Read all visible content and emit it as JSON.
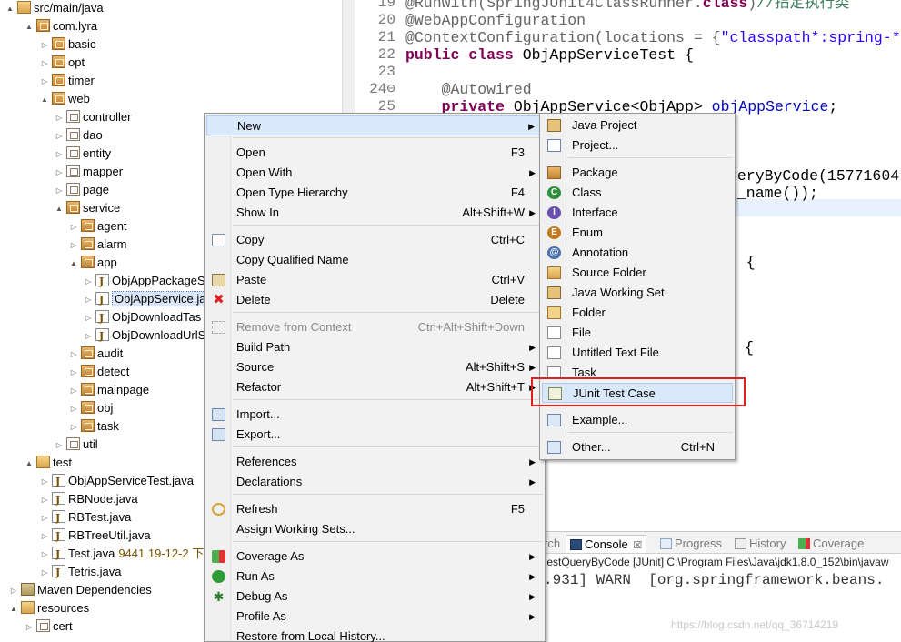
{
  "tree": {
    "rows": [
      {
        "label": "src/main/java"
      },
      {
        "label": "com.lyra"
      },
      {
        "label": "basic"
      },
      {
        "label": "opt"
      },
      {
        "label": "timer"
      },
      {
        "label": "web"
      },
      {
        "label": "controller"
      },
      {
        "label": "dao"
      },
      {
        "label": "entity"
      },
      {
        "label": "mapper"
      },
      {
        "label": "page"
      },
      {
        "label": "service"
      },
      {
        "label": "agent"
      },
      {
        "label": "alarm"
      },
      {
        "label": "app"
      },
      {
        "label": "ObjAppPackageS"
      },
      {
        "label": "ObjAppService.jav"
      },
      {
        "label": "ObjDownloadTas"
      },
      {
        "label": "ObjDownloadUrlS"
      },
      {
        "label": "audit"
      },
      {
        "label": "detect"
      },
      {
        "label": "mainpage"
      },
      {
        "label": "obj"
      },
      {
        "label": "task"
      },
      {
        "label": "util"
      },
      {
        "label": "test"
      },
      {
        "label": "ObjAppServiceTest.java"
      },
      {
        "label": "RBNode.java"
      },
      {
        "label": "RBTest.java"
      },
      {
        "label": "RBTreeUtil.java"
      },
      {
        "label": "Test.java",
        "extra": "9441  19-12-2 下"
      },
      {
        "label": "Tetris.java"
      },
      {
        "label": "Maven Dependencies"
      },
      {
        "label": "resources"
      },
      {
        "label": "cert"
      }
    ]
  },
  "editor": {
    "lines": [
      {
        "n": "19",
        "text": "@RunWith(SpringJUnit4ClassRunner.class)//指定执行类"
      },
      {
        "n": "20",
        "text": "@WebAppConfiguration"
      },
      {
        "n": "21",
        "text": "@ContextConfiguration(locations = {\"classpath*:spring-*"
      },
      {
        "n": "22",
        "text": "public class ObjAppServiceTest {"
      },
      {
        "n": "23",
        "text": ""
      },
      {
        "n": "24⊖",
        "text": "    @Autowired"
      },
      {
        "n": "25",
        "text": "    private ObjAppService<ObjApp> objAppService;"
      }
    ],
    "fragments": [
      "ueryByCode(15771604",
      "p_name());",
      ") {",
      "{"
    ]
  },
  "context_menu": {
    "items": [
      {
        "label": "New",
        "accel": "",
        "arrow": "▶"
      },
      {
        "label": "Open",
        "accel": "F3"
      },
      {
        "label": "Open With",
        "arrow": "▶"
      },
      {
        "label": "Open Type Hierarchy",
        "accel": "F4"
      },
      {
        "label": "Show In",
        "accel": "Alt+Shift+W",
        "arrow": "▶"
      },
      {
        "label": "Copy",
        "accel": "Ctrl+C"
      },
      {
        "label": "Copy Qualified Name"
      },
      {
        "label": "Paste",
        "accel": "Ctrl+V"
      },
      {
        "label": "Delete",
        "accel": "Delete"
      },
      {
        "label": "Remove from Context",
        "accel": "Ctrl+Alt+Shift+Down"
      },
      {
        "label": "Build Path",
        "arrow": "▶"
      },
      {
        "label": "Source",
        "accel": "Alt+Shift+S",
        "arrow": "▶"
      },
      {
        "label": "Refactor",
        "accel": "Alt+Shift+T",
        "arrow": "▶"
      },
      {
        "label": "Import..."
      },
      {
        "label": "Export..."
      },
      {
        "label": "References",
        "arrow": "▶"
      },
      {
        "label": "Declarations",
        "arrow": "▶"
      },
      {
        "label": "Refresh",
        "accel": "F5"
      },
      {
        "label": "Assign Working Sets..."
      },
      {
        "label": "Coverage As",
        "arrow": "▶"
      },
      {
        "label": "Run As",
        "arrow": "▶"
      },
      {
        "label": "Debug As",
        "arrow": "▶"
      },
      {
        "label": "Profile As",
        "arrow": "▶"
      },
      {
        "label": "Restore from Local History..."
      }
    ]
  },
  "new_submenu": {
    "items": [
      {
        "label": "Java Project",
        "icon": "java-project-icon"
      },
      {
        "label": "Project...",
        "icon": "project-icon"
      },
      {
        "label": "Package",
        "icon": "package-icon"
      },
      {
        "label": "Class",
        "icon": "class-icon"
      },
      {
        "label": "Interface",
        "icon": "interface-icon"
      },
      {
        "label": "Enum",
        "icon": "enum-icon"
      },
      {
        "label": "Annotation",
        "icon": "annotation-icon"
      },
      {
        "label": "Source Folder",
        "icon": "source-folder-icon"
      },
      {
        "label": "Java Working Set",
        "icon": "working-set-icon"
      },
      {
        "label": "Folder",
        "icon": "folder-icon"
      },
      {
        "label": "File",
        "icon": "file-icon"
      },
      {
        "label": "Untitled Text File",
        "icon": "text-file-icon"
      },
      {
        "label": "Task",
        "icon": "task-icon"
      },
      {
        "label": "JUnit Test Case",
        "icon": "junit-icon"
      },
      {
        "label": "Example...",
        "icon": "example-icon"
      },
      {
        "label": "Other...",
        "accel": "Ctrl+N",
        "icon": "other-icon"
      }
    ]
  },
  "console": {
    "tabs": [
      "rch",
      "Console",
      "Progress",
      "History",
      "Coverage"
    ],
    "close_glyph": "☒",
    "description": "testQueryByCode [JUnit] C:\\Program Files\\Java\\jdk1.8.0_152\\bin\\javaw",
    "output": ".931] WARN  [org.springframework.beans."
  },
  "watermark": "https://blog.csdn.net/qq_36714219",
  "colors": {
    "highlight_box": "#e0201e",
    "menu_hover": "#d9e8fb",
    "keyword": "#7f0055",
    "string": "#2a00ff"
  }
}
